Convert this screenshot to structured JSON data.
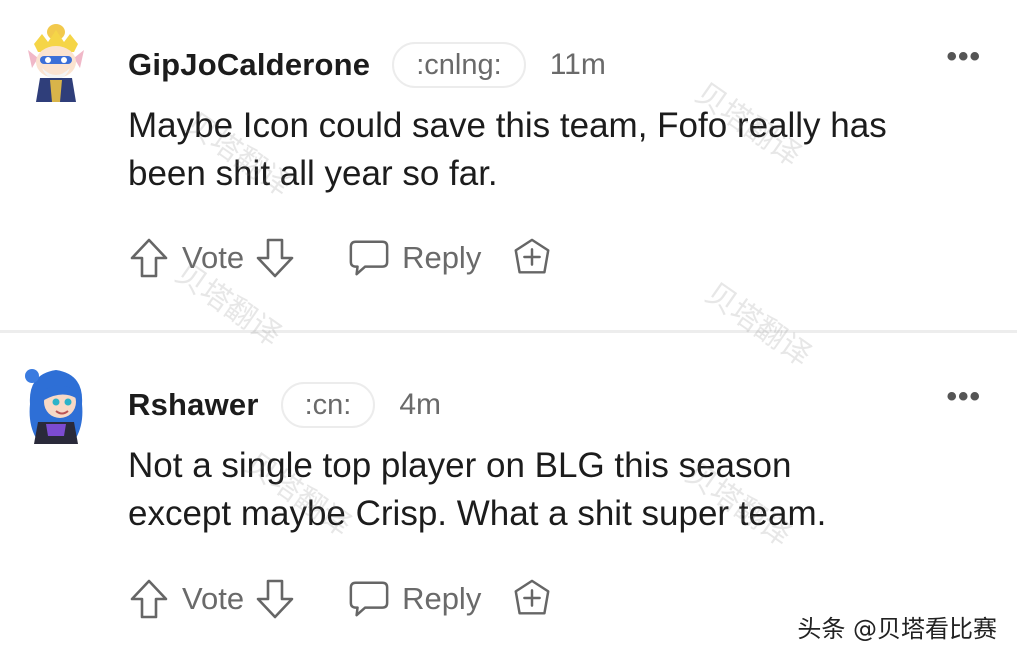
{
  "comments": [
    {
      "username": "GipJoCalderone",
      "flair": ":cnlng:",
      "time": "11m",
      "more": "•••",
      "body_lines": [
        "Maybe Icon could save this team, Fofo really has",
        "been shit all year so far."
      ],
      "vote_label": "Vote",
      "reply_label": "Reply"
    },
    {
      "username": "Rshawer",
      "flair": ":cn:",
      "time": "4m",
      "more": "•••",
      "body_lines": [
        "Not a single top player on BLG this season",
        "except maybe Crisp. What a shit super team."
      ],
      "vote_label": "Vote",
      "reply_label": "Reply"
    }
  ],
  "watermark_text": "贝塔翻译",
  "footer_watermark": "头条 @贝塔看比赛",
  "icons": [
    "upvote-icon",
    "downvote-icon",
    "reply-bubble-icon",
    "award-plus-icon",
    "more-options-icon"
  ],
  "colors": {
    "text": "#1c1c1c",
    "muted": "#6a6a6a",
    "divider": "#ededed",
    "flair_border": "#ececec"
  }
}
